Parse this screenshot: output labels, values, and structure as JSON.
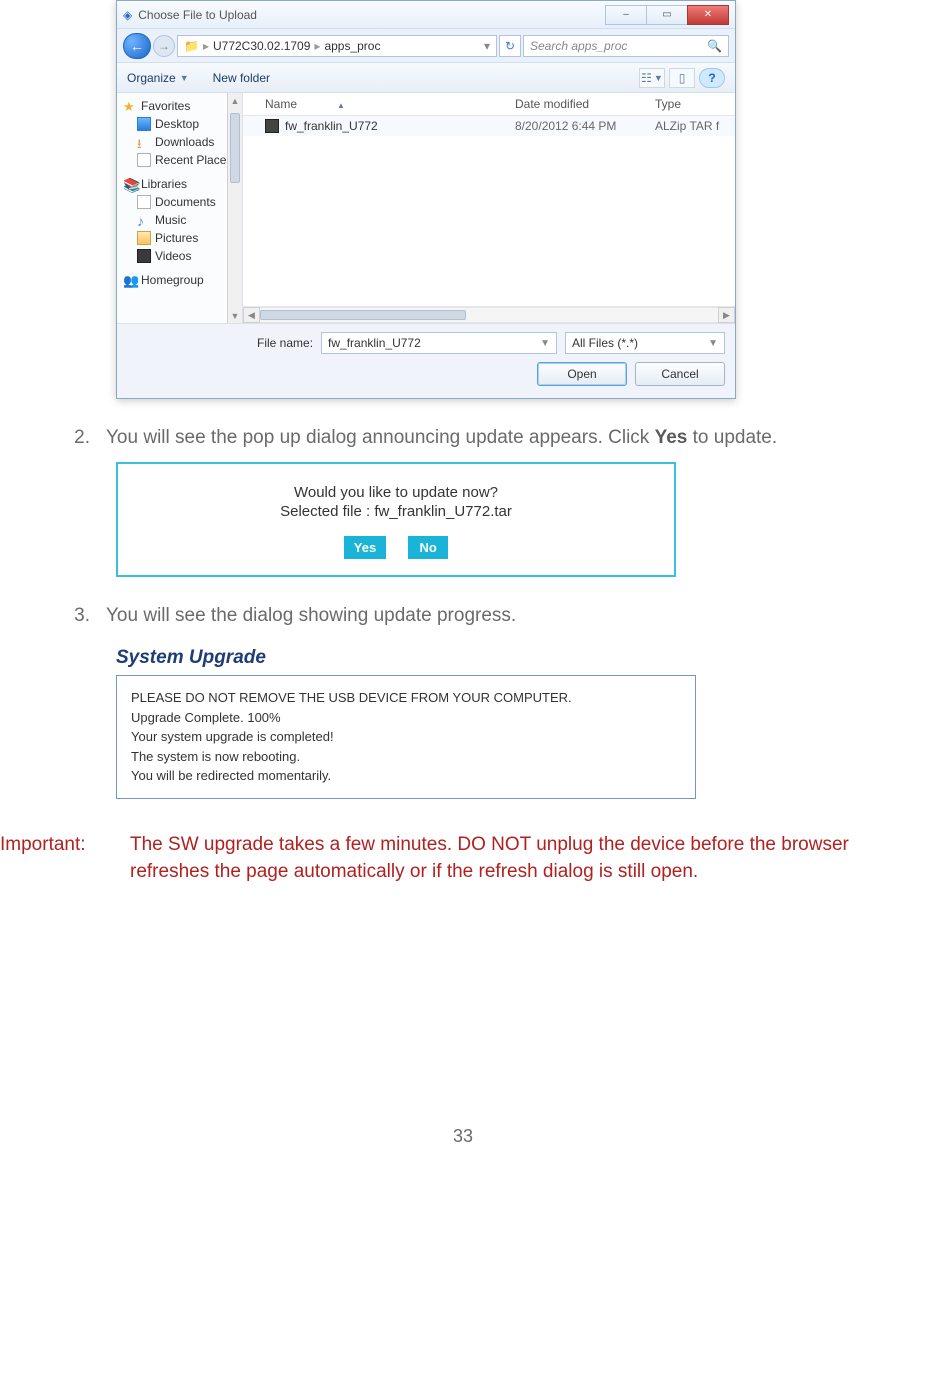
{
  "fileDialog": {
    "title": "Choose File to Upload",
    "breadcrumb": {
      "part1": "U772C30.02.1709",
      "part2": "apps_proc"
    },
    "searchPlaceholder": "Search apps_proc",
    "toolbar": {
      "organize": "Organize",
      "newFolder": "New folder"
    },
    "navPane": {
      "favorites": "Favorites",
      "favItems": [
        "Desktop",
        "Downloads",
        "Recent Places"
      ],
      "libraries": "Libraries",
      "libItems": [
        "Documents",
        "Music",
        "Pictures",
        "Videos"
      ],
      "homegroup": "Homegroup"
    },
    "columns": {
      "name": "Name",
      "date": "Date modified",
      "type": "Type"
    },
    "file": {
      "name": "fw_franklin_U772",
      "date": "8/20/2012 6:44 PM",
      "type": "ALZip TAR f"
    },
    "fileNameLabel": "File name:",
    "fileNameValue": "fw_franklin_U772",
    "filter": "All Files (*.*)",
    "open": "Open",
    "cancel": "Cancel"
  },
  "steps": {
    "s2": {
      "num": "2.",
      "textA": "You will see the pop up dialog announcing update appears. Click ",
      "bold": "Yes",
      "textB": " to update."
    },
    "s3": {
      "num": "3.",
      "text": "You will see the dialog showing update progress."
    }
  },
  "confirm": {
    "line1": "Would you like to update now?",
    "line2": "Selected file : fw_franklin_U772.tar",
    "yes": "Yes",
    "no": "No"
  },
  "upgrade": {
    "title": "System Upgrade",
    "l1": "PLEASE DO NOT REMOVE THE USB DEVICE FROM YOUR COMPUTER.",
    "l2": "Upgrade Complete. 100%",
    "l3": "Your system upgrade is completed!",
    "l4": "The system is now rebooting.",
    "l5": "You will be redirected momentarily."
  },
  "important": {
    "label": "Important:",
    "msg": "The SW upgrade takes a few minutes. DO NOT unplug the device before the browser refreshes the page automatically or if the refresh dialog is still open."
  },
  "pageNumber": "33"
}
